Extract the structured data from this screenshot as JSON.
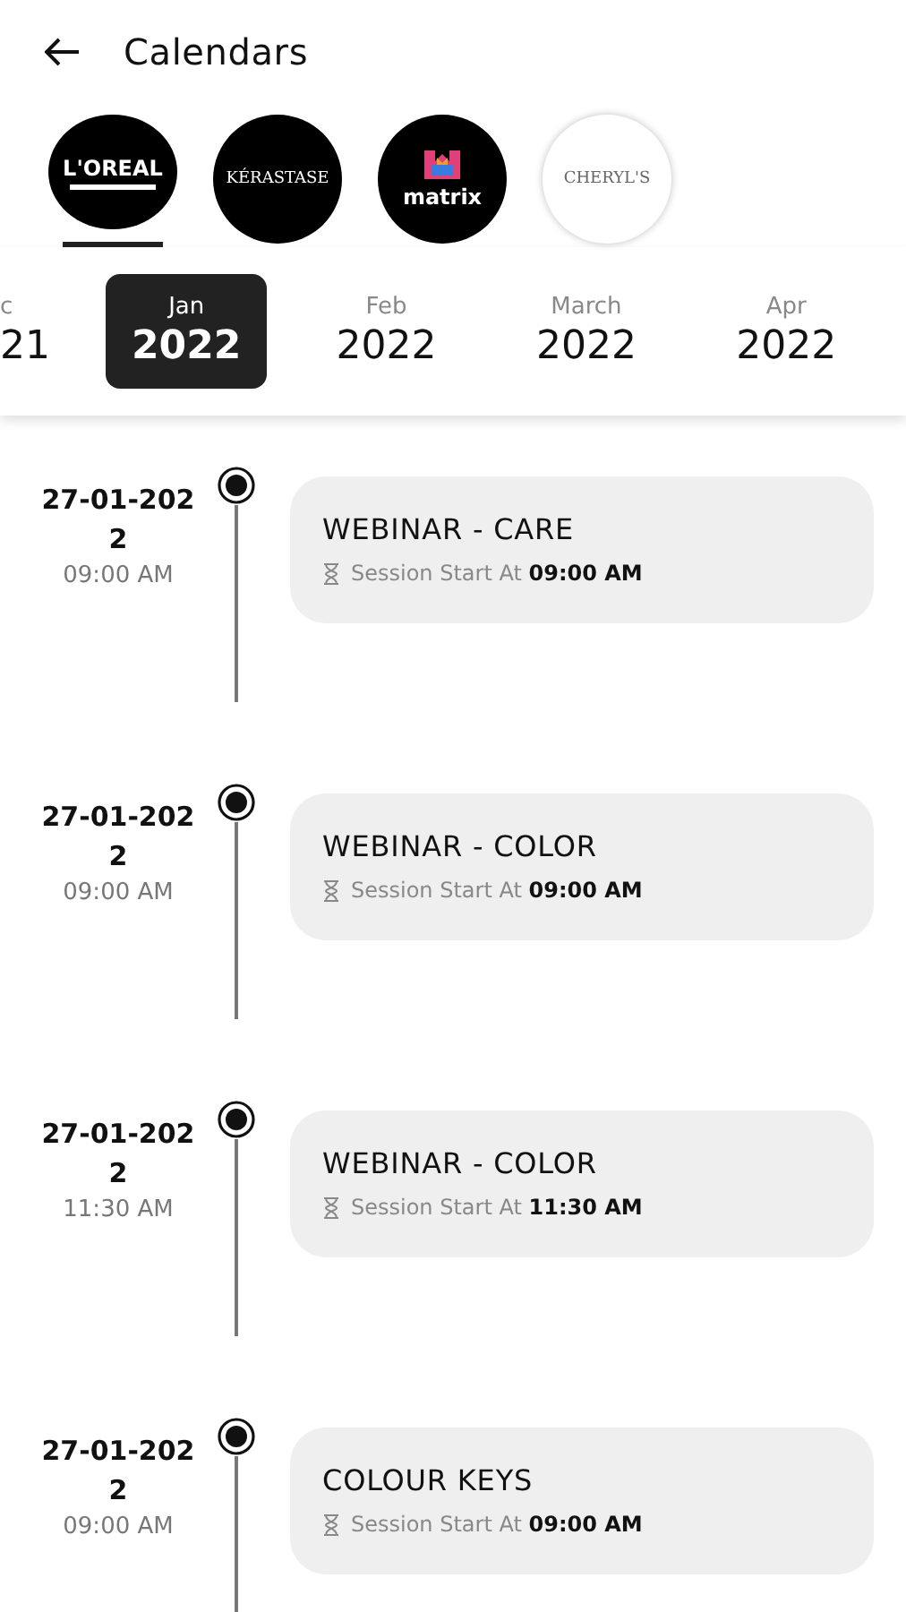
{
  "header": {
    "title": "Calendars"
  },
  "brands": [
    {
      "name": "L'OREAL",
      "kind": "banner",
      "selected": true
    },
    {
      "name": "KÉRASTASE",
      "kind": "plain",
      "selected": false
    },
    {
      "name": "matrix",
      "kind": "mark",
      "selected": false
    },
    {
      "name": "CHERYL'S",
      "kind": "light",
      "selected": false
    }
  ],
  "months": [
    {
      "month": "c",
      "year": "21",
      "selected": false
    },
    {
      "month": "Jan",
      "year": "2022",
      "selected": true
    },
    {
      "month": "Feb",
      "year": "2022",
      "selected": false
    },
    {
      "month": "March",
      "year": "2022",
      "selected": false
    },
    {
      "month": "Apr",
      "year": "2022",
      "selected": false
    }
  ],
  "events": [
    {
      "date": "27-01-2022",
      "time": "09:00 AM",
      "title": "WEBINAR - CARE",
      "start": "Session Start At **09:00 AM**"
    },
    {
      "date": "27-01-2022",
      "time": "09:00 AM",
      "title": "WEBINAR - COLOR",
      "start": "Session Start At **09:00 AM**"
    },
    {
      "date": "27-01-2022",
      "time": "11:30 AM",
      "title": "WEBINAR - COLOR",
      "start": "Session Start At **11:30 AM**"
    },
    {
      "date": "27-01-2022",
      "time": "09:00 AM",
      "title": "COLOUR KEYS",
      "start": "Session Start At **09:00 AM**"
    }
  ]
}
